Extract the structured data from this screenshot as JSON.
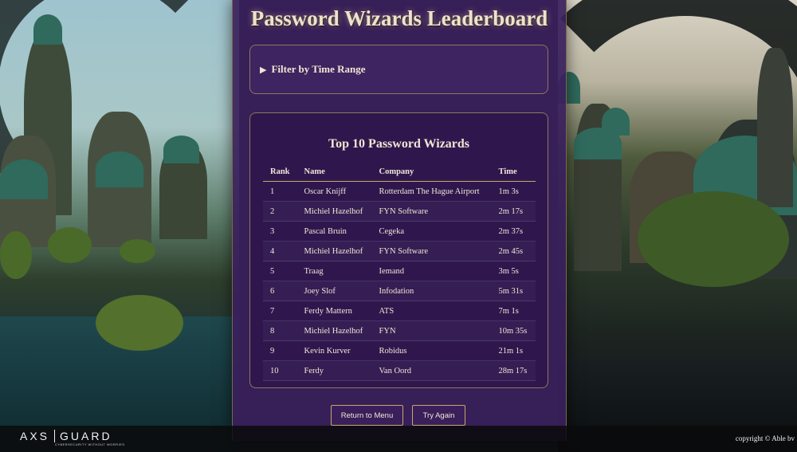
{
  "page": {
    "title": "Password Wizards Leaderboard"
  },
  "filter": {
    "toggle_icon": "▶",
    "label": "Filter by Time Range"
  },
  "leaderboard": {
    "title": "Top 10 Password Wizards",
    "columns": [
      "Rank",
      "Company",
      "Time",
      "Name"
    ],
    "headers": {
      "rank": "Rank",
      "name": "Name",
      "company": "Company",
      "time": "Time"
    },
    "rows": [
      {
        "rank": "1",
        "name": "Oscar Knijff",
        "company": "Rotterdam The Hague Airport",
        "time": "1m 3s"
      },
      {
        "rank": "2",
        "name": "Michiel Hazelhof",
        "company": "FYN Software",
        "time": "2m 17s"
      },
      {
        "rank": "3",
        "name": "Pascal Bruin",
        "company": "Cegeka",
        "time": "2m 37s"
      },
      {
        "rank": "4",
        "name": "Michiel Hazelhof",
        "company": "FYN Software",
        "time": "2m 45s"
      },
      {
        "rank": "5",
        "name": "Traag",
        "company": "Iemand",
        "time": "3m 5s"
      },
      {
        "rank": "6",
        "name": "Joey Slof",
        "company": "Infodation",
        "time": "5m 31s"
      },
      {
        "rank": "7",
        "name": "Ferdy Mattern",
        "company": "ATS",
        "time": "7m 1s"
      },
      {
        "rank": "8",
        "name": "Michiel Hazelhof",
        "company": "FYN",
        "time": "10m 35s"
      },
      {
        "rank": "9",
        "name": "Kevin Kurver",
        "company": "Robidus",
        "time": "21m 1s"
      },
      {
        "rank": "10",
        "name": "Ferdy",
        "company": "Van Oord",
        "time": "28m 17s"
      }
    ]
  },
  "buttons": {
    "return_label": "Return to Menu",
    "retry_label": "Try Again"
  },
  "footer": {
    "logo_left": "AXS",
    "logo_right": "GUARD",
    "logo_tagline": "CYBERSECURITY WITHOUT WORRIES",
    "copyright": "copyright © Able bv"
  },
  "colors": {
    "panel": "#3a205c",
    "accent_gold": "#c8a86a",
    "text": "#efe2cc"
  }
}
